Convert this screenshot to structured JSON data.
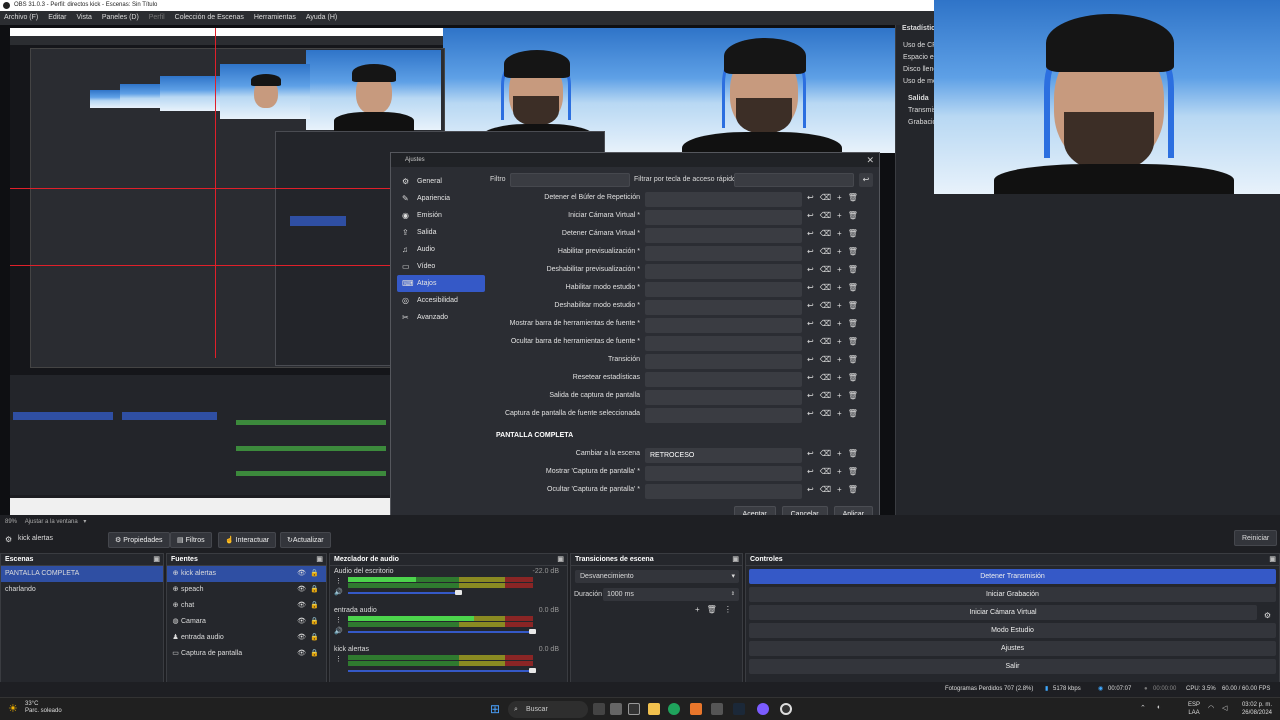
{
  "window": {
    "title": "OBS 31.0.3 - Perfil: directos kick - Escenas: Sin Título"
  },
  "menu": [
    "Archivo (F)",
    "Editar",
    "Vista",
    "Paneles (D)",
    "Perfil",
    "Colección de Escenas",
    "Herramientas",
    "Ayuda (H)"
  ],
  "stats": {
    "title": "Estadísticas",
    "lines": [
      "Uso de CPU",
      "Espacio en",
      "Disco lleno",
      "Uso de me"
    ],
    "output_title": "Salida",
    "output_lines": [
      "Transmis",
      "Grabació"
    ]
  },
  "dialog": {
    "title": "Ajustes",
    "nav": [
      {
        "label": "General",
        "icon": "⚙"
      },
      {
        "label": "Apariencia",
        "icon": "✎"
      },
      {
        "label": "Emisión",
        "icon": "◉"
      },
      {
        "label": "Salida",
        "icon": "⇪"
      },
      {
        "label": "Audio",
        "icon": "♫"
      },
      {
        "label": "Vídeo",
        "icon": "▭"
      },
      {
        "label": "Atajos",
        "icon": "⌨"
      },
      {
        "label": "Accesibilidad",
        "icon": "◎"
      },
      {
        "label": "Avanzado",
        "icon": "✂"
      }
    ],
    "filter_label": "Filtro",
    "filter_hotkey_label": "Filtrar por tecla de acceso rápido",
    "hotkeys": [
      "Detener el Búfer de Repetición",
      "Iniciar Cámara Virtual *",
      "Detener Cámara Virtual *",
      "Habilitar previsualización *",
      "Deshabilitar previsualización *",
      "Habilitar modo estudio *",
      "Deshabilitar modo estudio *",
      "Mostrar barra de herramientas de fuente *",
      "Ocultar barra de herramientas de fuente *",
      "Transición",
      "Resetear estadísticas",
      "Salida de captura de pantalla",
      "Captura de pantalla de fuente seleccionada"
    ],
    "section_title": "PANTALLA COMPLETA",
    "section_hotkeys": [
      {
        "label": "Cambiar a la escena",
        "value": "RETROCESO"
      },
      {
        "label": "Mostrar 'Captura de pantalla' *",
        "value": ""
      },
      {
        "label": "Ocultar 'Captura de pantalla' *",
        "value": ""
      }
    ],
    "buttons": {
      "accept": "Aceptar",
      "cancel": "Cancelar",
      "apply": "Aplicar"
    }
  },
  "under_preview": {
    "zoom": "89%",
    "fit": "Ajustar a la ventana"
  },
  "source_toolbar": {
    "source_name": "kick alertas",
    "properties": "Propiedades",
    "filters": "Filtros",
    "interact": "Interactuar",
    "refresh": "Actualizar"
  },
  "restart_button": "Reiniciar",
  "scenes": {
    "title": "Escenas",
    "items": [
      "PANTALLA COMPLETA",
      "charlando"
    ],
    "selected": 0
  },
  "sources": {
    "title": "Fuentes",
    "items": [
      {
        "label": "kick alertas",
        "icon": "⊕"
      },
      {
        "label": "speach",
        "icon": "⊕"
      },
      {
        "label": "chat",
        "icon": "⊕"
      },
      {
        "label": "Camara",
        "icon": "◍"
      },
      {
        "label": "entrada audio",
        "icon": "♟"
      },
      {
        "label": "Captura de pantalla",
        "icon": "▭"
      }
    ],
    "selected": 0
  },
  "mixer": {
    "title": "Mezclador de audio",
    "channels": [
      {
        "name": "Audio del escritorio",
        "db": "-22.0 dB",
        "level": 0.37,
        "volume": 0.6
      },
      {
        "name": "entrada audio",
        "db": "0.0 dB",
        "level": 0.68,
        "volume": 1.0
      },
      {
        "name": "kick alertas",
        "db": "0.0 dB",
        "level": 0,
        "volume": 1.0
      }
    ]
  },
  "transitions": {
    "title": "Transiciones de escena",
    "selected": "Desvanecimiento",
    "duration_label": "Duración",
    "duration_value": "1000 ms"
  },
  "controls": {
    "title": "Controles",
    "buttons": [
      "Detener Transmisión",
      "Iniciar Grabación",
      "Iniciar Cámara Virtual",
      "Modo Estudio",
      "Ajustes",
      "Salir"
    ],
    "active": 0
  },
  "status": {
    "dropped": "Fotogramas Perdidos 707 (2.8%)",
    "bitrate": "5178 kbps",
    "stream_time": "00:07:07",
    "rec_time": "00:00:00",
    "cpu": "CPU: 3.5%",
    "fps": "60.00 / 60.00 FPS"
  },
  "taskbar": {
    "weather_temp": "33°C",
    "weather_desc": "Parc. soleado",
    "search": "Buscar",
    "lang1": "ESP",
    "lang2": "LAA",
    "time": "03:02 p. m.",
    "date": "26/08/2024"
  }
}
